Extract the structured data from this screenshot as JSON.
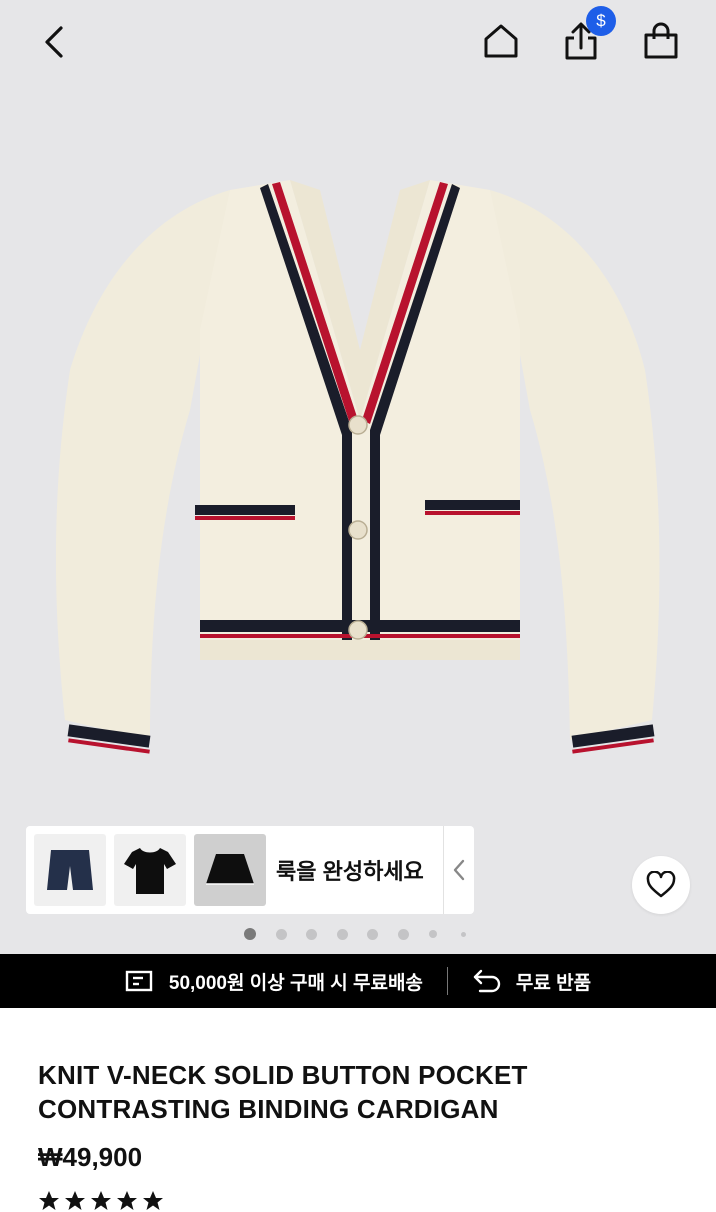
{
  "topbar": {
    "back_icon": "chevron-left-icon",
    "home_icon": "home-icon",
    "share_icon": "share-icon",
    "share_badge": "$",
    "bag_icon": "shopping-bag-icon",
    "badge_color": "#1e5ee8"
  },
  "gallery": {
    "image_subject": "cream knit v-neck cardigan with navy and red trim",
    "total_dots": 8,
    "active_dot": 0
  },
  "complete_look": {
    "label": "룩을 완성하세요",
    "items": [
      "navy shorts",
      "black t-shirt",
      "black pleated skirt"
    ]
  },
  "banner": {
    "shipping_text": "50,000원 이상 구매 시 무료배송",
    "return_text": "무료 반품"
  },
  "product": {
    "title": "KNIT V-NECK SOLID BUTTON POCKET CONTRASTING BINDING CARDIGAN",
    "price": "₩49,900"
  }
}
